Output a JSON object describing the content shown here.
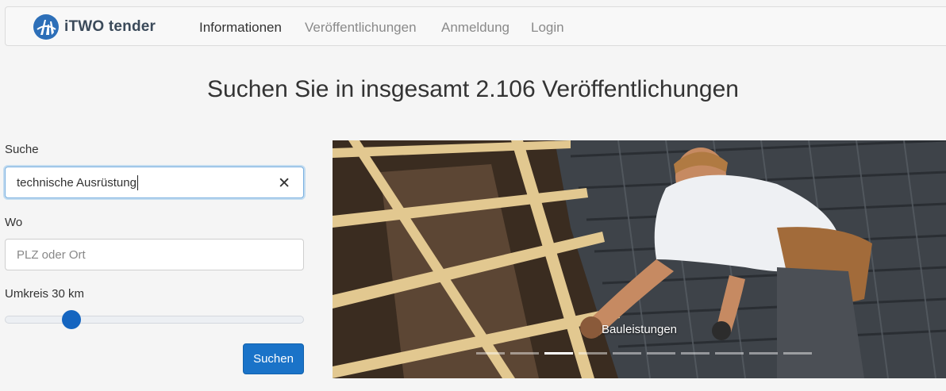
{
  "brand": {
    "name": "iTWO tender",
    "logo_icon": "itwo-logo-icon"
  },
  "nav": {
    "items": [
      {
        "label": "Informationen",
        "active": true
      },
      {
        "label": "Veröffentlichungen",
        "active": false
      },
      {
        "label": "Anmeldung",
        "active": false
      },
      {
        "label": "Login",
        "active": false
      }
    ]
  },
  "headline": "Suchen Sie in insgesamt 2.106 Veröffentlichungen",
  "search": {
    "label": "Suche",
    "value": "technische Ausrüstung",
    "clear_icon": "close-icon"
  },
  "location": {
    "label": "Wo",
    "placeholder": "PLZ oder Ort"
  },
  "radius": {
    "label": "Umkreis 30 km",
    "value_km": 30,
    "slider_fraction": 0.22
  },
  "submit_label": "Suchen",
  "carousel": {
    "caption": "Bauleistungen",
    "slide_count": 10,
    "active_index": 2
  },
  "colors": {
    "accent": "#1a73c8",
    "slider_thumb": "#1565c0",
    "page_bg": "#f5f5f5"
  }
}
